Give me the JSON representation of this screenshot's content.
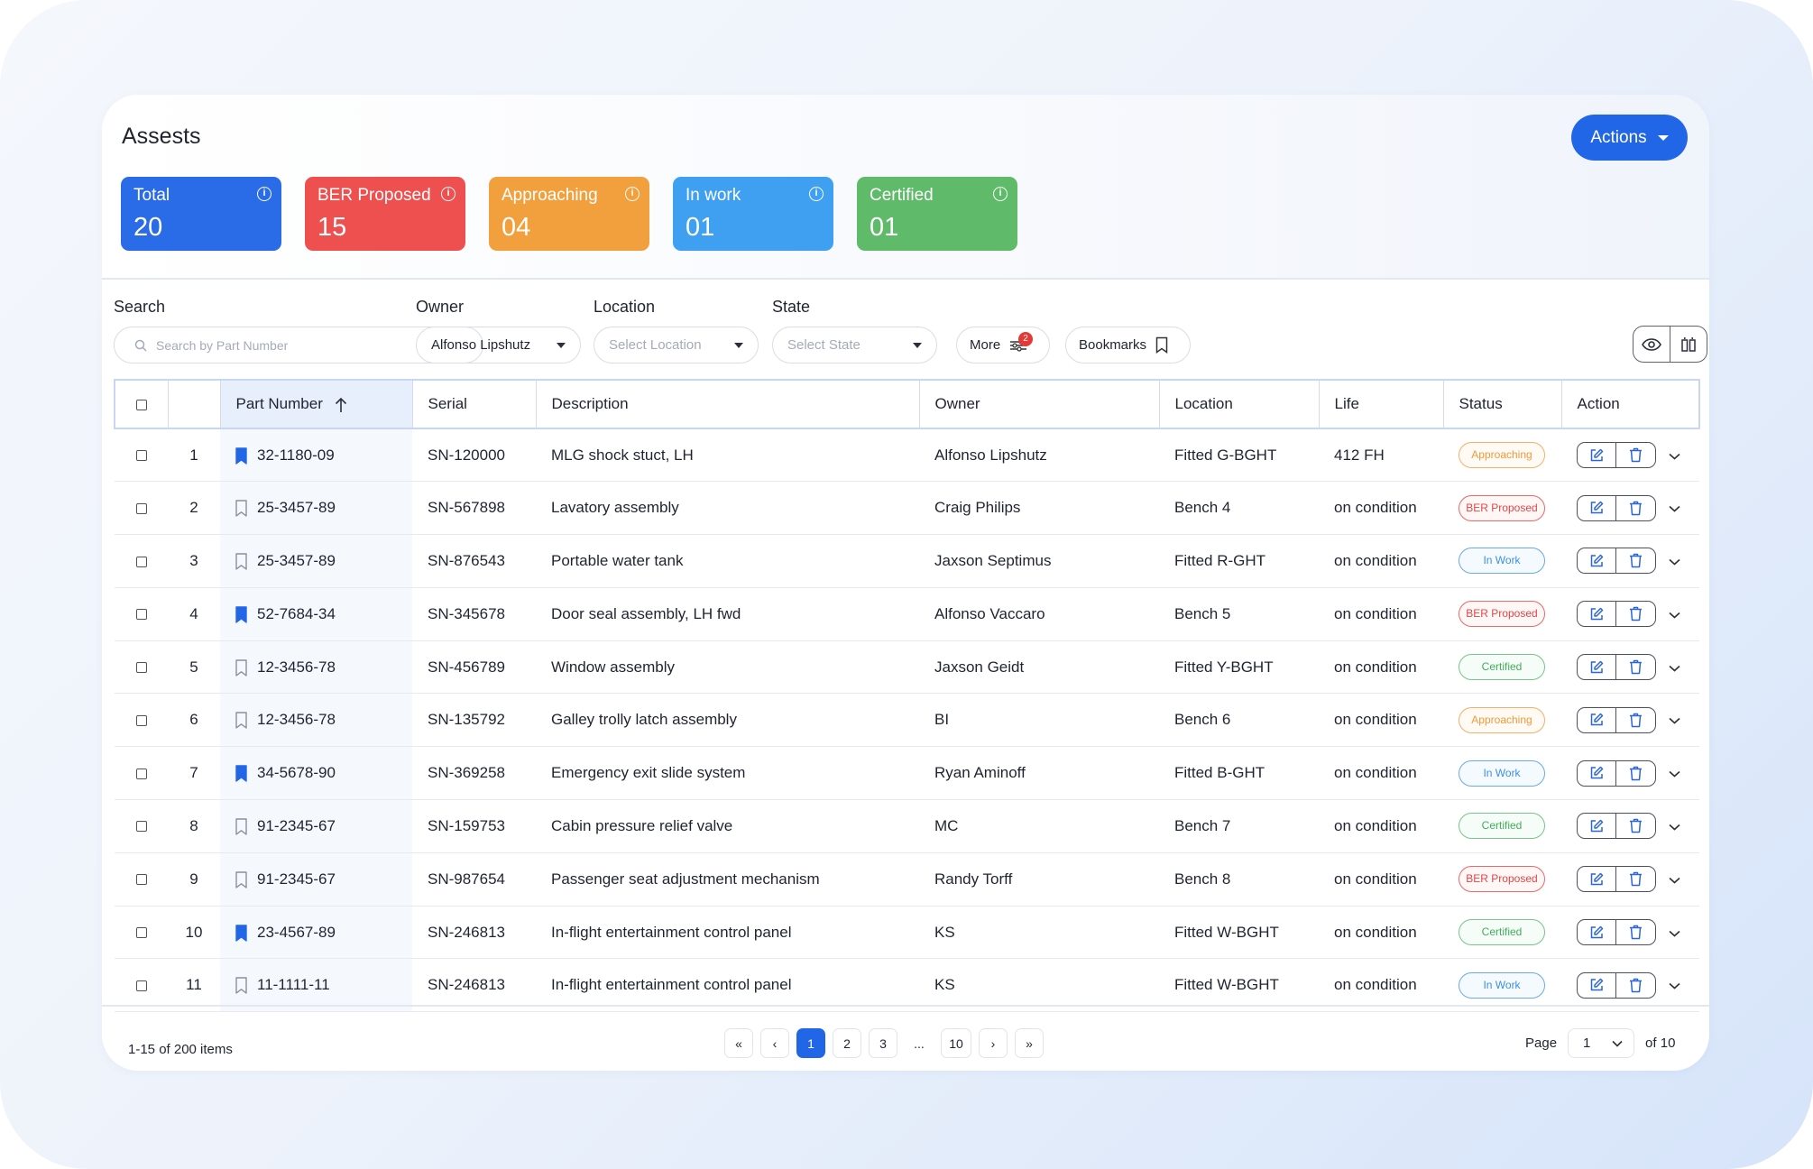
{
  "header": {
    "title": "Assests",
    "actions_label": "Actions"
  },
  "stats": [
    {
      "label": "Total",
      "value": "20",
      "color": "#2a6be8"
    },
    {
      "label": "BER Proposed",
      "value": "15",
      "color": "#ee4f4f"
    },
    {
      "label": "Approaching",
      "value": "04",
      "color": "#f2a03d"
    },
    {
      "label": "In work",
      "value": "01",
      "color": "#3f9ff0"
    },
    {
      "label": "Certified",
      "value": "01",
      "color": "#5fba6a"
    }
  ],
  "filters": {
    "search_label": "Search",
    "search_placeholder": "Search by Part Number",
    "owner_label": "Owner",
    "owner_value": "Alfonso Lipshutz",
    "location_label": "Location",
    "location_placeholder": "Select Location",
    "state_label": "State",
    "state_placeholder": "Select State",
    "more_label": "More",
    "more_badge": "2",
    "bookmarks_label": "Bookmarks"
  },
  "table": {
    "columns": [
      "Part Number",
      "Serial",
      "Description",
      "Owner",
      "Location",
      "Life",
      "Status",
      "Action"
    ],
    "rows": [
      {
        "num": "1",
        "bookmarked": true,
        "part": "32-1180-09",
        "serial": "SN-120000",
        "desc": "MLG shock stuct, LH",
        "owner": "Alfonso Lipshutz",
        "location": "Fitted G-BGHT",
        "life": "412 FH",
        "status": "Approaching"
      },
      {
        "num": "2",
        "bookmarked": false,
        "part": "25-3457-89",
        "serial": "SN-567898",
        "desc": "Lavatory assembly",
        "owner": "Craig Philips",
        "location": "Bench 4",
        "life": "on condition",
        "status": "BER Proposed"
      },
      {
        "num": "3",
        "bookmarked": false,
        "part": "25-3457-89",
        "serial": "SN-876543",
        "desc": "Portable water tank",
        "owner": "Jaxson Septimus",
        "location": "Fitted R-GHT",
        "life": "on condition",
        "status": "In Work"
      },
      {
        "num": "4",
        "bookmarked": true,
        "part": "52-7684-34",
        "serial": "SN-345678",
        "desc": "Door seal assembly, LH fwd",
        "owner": "Alfonso Vaccaro",
        "location": "Bench 5",
        "life": "on condition",
        "status": "BER Proposed"
      },
      {
        "num": "5",
        "bookmarked": false,
        "part": "12-3456-78",
        "serial": "SN-456789",
        "desc": "Window assembly",
        "owner": "Jaxson Geidt",
        "location": "Fitted Y-BGHT",
        "life": "on condition",
        "status": "Certified"
      },
      {
        "num": "6",
        "bookmarked": false,
        "part": "12-3456-78",
        "serial": "SN-135792",
        "desc": "Galley trolly latch assembly",
        "owner": "BI",
        "location": "Bench 6",
        "life": "on condition",
        "status": "Approaching"
      },
      {
        "num": "7",
        "bookmarked": true,
        "part": "34-5678-90",
        "serial": "SN-369258",
        "desc": "Emergency exit slide system",
        "owner": "Ryan Aminoff",
        "location": "Fitted B-GHT",
        "life": "on condition",
        "status": "In Work"
      },
      {
        "num": "8",
        "bookmarked": false,
        "part": "91-2345-67",
        "serial": "SN-159753",
        "desc": "Cabin pressure relief valve",
        "owner": "MC",
        "location": "Bench 7",
        "life": "on condition",
        "status": "Certified"
      },
      {
        "num": "9",
        "bookmarked": false,
        "part": "91-2345-67",
        "serial": "SN-987654",
        "desc": "Passenger seat adjustment mechanism",
        "owner": "Randy Torff",
        "location": "Bench 8",
        "life": "on condition",
        "status": "BER Proposed"
      },
      {
        "num": "10",
        "bookmarked": true,
        "part": "23-4567-89",
        "serial": "SN-246813",
        "desc": "In-flight entertainment control panel",
        "owner": "KS",
        "location": "Fitted W-BGHT",
        "life": "on condition",
        "status": "Certified"
      },
      {
        "num": "11",
        "bookmarked": false,
        "part": "11-1111-11",
        "serial": "SN-246813",
        "desc": "In-flight entertainment control panel",
        "owner": "KS",
        "location": "Fitted W-BGHT",
        "life": "on condition",
        "status": "In Work"
      }
    ]
  },
  "pagination": {
    "summary": "1-15 of 200 items",
    "first": "«",
    "prev": "‹",
    "next": "›",
    "last": "»",
    "pages": [
      "1",
      "2",
      "3",
      "...",
      "10"
    ],
    "current": "1",
    "page_label": "Page",
    "page_value": "1",
    "of_label": "of 10"
  },
  "colors": {
    "accent": "#2266e8",
    "bookmark": "#2266e8"
  }
}
